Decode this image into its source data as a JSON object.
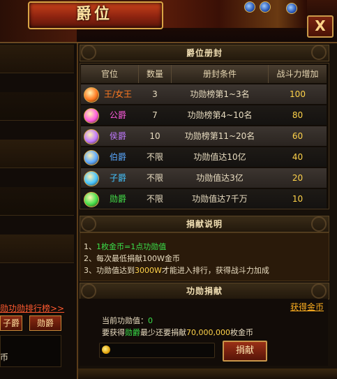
{
  "window": {
    "title": "爵位",
    "close_label": "X"
  },
  "left_panel": {
    "link_text": "勋功勋排行榜>>",
    "btn_zijue": "子爵",
    "btn_xunjue": "勋爵",
    "bottom_text": "币"
  },
  "rank_section": {
    "title": "爵位册封",
    "headers": [
      "官位",
      "数量",
      "册封条件",
      "战斗力增加"
    ],
    "rows": [
      {
        "rank": "王/女王",
        "count": "3",
        "condition": "功勋榜第1~3名",
        "power": "100",
        "color": "#ff7a22",
        "icon": "king-badge-icon"
      },
      {
        "rank": "公爵",
        "count": "7",
        "condition": "功勋榜第4~10名",
        "power": "80",
        "color": "#ff5ce0",
        "icon": "duke-badge-icon"
      },
      {
        "rank": "侯爵",
        "count": "10",
        "condition": "功勋榜第11~20名",
        "power": "60",
        "color": "#c07aff",
        "icon": "marquis-badge-icon"
      },
      {
        "rank": "伯爵",
        "count": "不限",
        "condition": "功勋值达10亿",
        "power": "40",
        "color": "#5aa8ff",
        "icon": "earl-badge-icon"
      },
      {
        "rank": "子爵",
        "count": "不限",
        "condition": "功勋值达3亿",
        "power": "20",
        "color": "#44c4ff",
        "icon": "viscount-badge-icon"
      },
      {
        "rank": "勋爵",
        "count": "不限",
        "condition": "功勋值达7千万",
        "power": "10",
        "color": "#44e04a",
        "icon": "baron-badge-icon"
      }
    ]
  },
  "donation_info": {
    "title": "捐献说明",
    "line1_prefix": "1、",
    "line1_green": "1枚金币=1点功勋值",
    "line2": "2、每次最低捐献100W金币",
    "line3_prefix": "3、功勋值达到",
    "line3_amount": "3000W",
    "line3_suffix": "才能进入排行，获得战斗力加成"
  },
  "donate_panel": {
    "title": "功勋捐献",
    "get_gold_link": "获得金币",
    "current_label": "当前功勋值：",
    "current_value": "0",
    "req_prefix": "要获得",
    "req_rank": "勋爵",
    "req_mid": "最少还要捐献",
    "req_amount": "70,000,000",
    "req_suffix": "枚金币",
    "donate_button": "捐献",
    "input_value": ""
  },
  "colors": {
    "green": "#3ae04a",
    "link_orange": "#ff5a30",
    "gold": "#ffd34a"
  }
}
